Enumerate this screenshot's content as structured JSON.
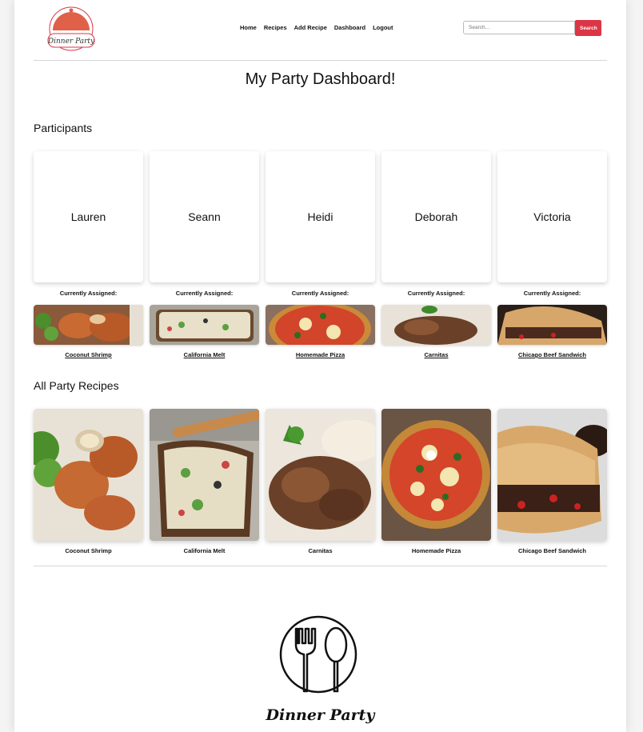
{
  "header": {
    "logo_text": "Dinner Party",
    "nav": [
      {
        "label": "Home"
      },
      {
        "label": "Recipes"
      },
      {
        "label": "Add Recipe"
      },
      {
        "label": "Dashboard"
      },
      {
        "label": "Logout"
      }
    ],
    "search": {
      "placeholder": "Search...",
      "button": "Search"
    }
  },
  "page_title": "My Party Dashboard!",
  "participants": {
    "heading": "Participants",
    "assigned_label": "Currently Assigned:",
    "people": [
      {
        "name": "Lauren",
        "recipe": "Coconut Shrimp",
        "image": "shrimp"
      },
      {
        "name": "Seann",
        "recipe": "California Melt",
        "image": "melt"
      },
      {
        "name": "Heidi",
        "recipe": "Homemade Pizza",
        "image": "pizza"
      },
      {
        "name": "Deborah",
        "recipe": "Carnitas",
        "image": "carnitas"
      },
      {
        "name": "Victoria",
        "recipe": "Chicago Beef Sandwich",
        "image": "beef"
      }
    ]
  },
  "recipes": {
    "heading": "All Party Recipes",
    "items": [
      {
        "name": "Coconut Shrimp",
        "image": "shrimp"
      },
      {
        "name": "California Melt",
        "image": "melt"
      },
      {
        "name": "Carnitas",
        "image": "carnitas"
      },
      {
        "name": "Homemade Pizza",
        "image": "pizza"
      },
      {
        "name": "Chicago Beef Sandwich",
        "image": "beef"
      }
    ]
  },
  "footer": {
    "brand": "Dinner Party",
    "icon": "fork-spoon-plate-icon"
  },
  "colors": {
    "accent": "#dc3545",
    "divider": "#d6d6d6"
  }
}
